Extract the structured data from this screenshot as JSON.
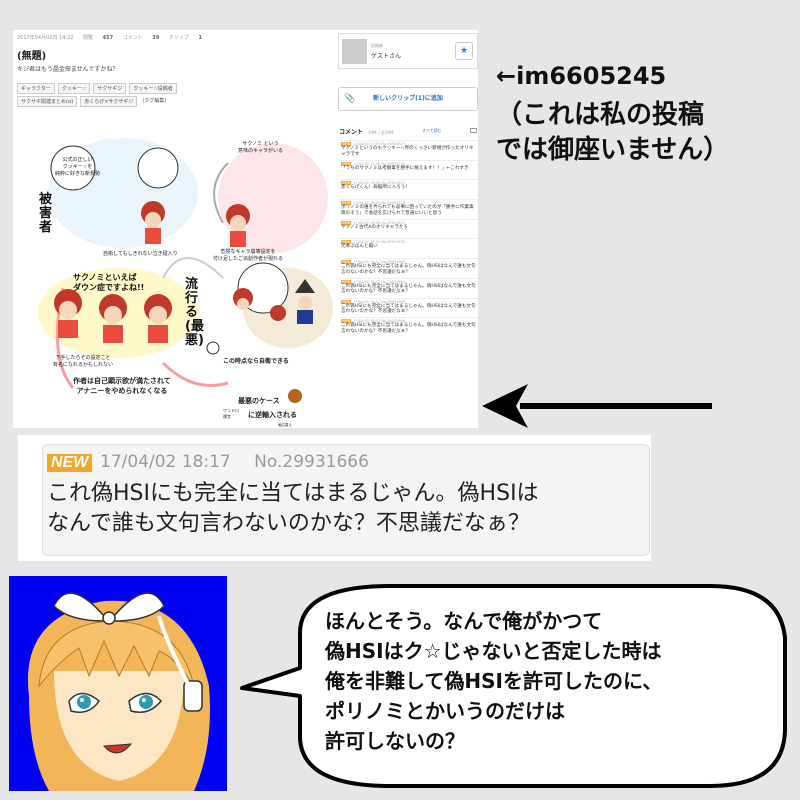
{
  "post": {
    "date_info": "2017年04月02日 14:22",
    "views_label": "閲覧",
    "views": "457",
    "comments_label": "コメント",
    "comments": "39",
    "clips_label": "クリップ",
    "clips": "1",
    "title": "(無題)",
    "description": "キジ君はもう晶金探ませんですかね？",
    "tags_row1": [
      "ギャラクター",
      "クッキー☆",
      "サクサギジ",
      "クッキー☆投稿者"
    ],
    "tags_row2": [
      "サクサギ関連まとめ(α)",
      "赤くらげ×サクサギジ"
    ],
    "tags_locked_label": "(タグ編集)"
  },
  "poster": {
    "label": "投稿者",
    "name": "ゲストさん",
    "star_glyph": "★"
  },
  "clip_button": {
    "label": "新しいクリップ(1)に追加",
    "icon": "paperclip-icon"
  },
  "comic": {
    "label_victim": "被害者",
    "label_trend": "流行る(最悪)",
    "speech_sakanomi": "サクノミといえば\nダウン症ですよね!!",
    "bubble_official": "公式の正しい\nクッキー☆を\n純粋に好きな新規勢",
    "caption_selfharm": "自衛してもしきれない泣き寝入り",
    "bubble_meaning": "サクノミ という\n意味のキャラがいる",
    "caption_spread": "危険なキャラ崩壊設定を\n付け足したご派創作者が現れる",
    "caption_defense": "この時点なら自衛できる",
    "caption_setting": "下手したらその設定こと\n有名になれるかもしれない",
    "caption_author": "作者は自己顕示欲が満たされて\nアナニーをやめられなくなる",
    "worst_case": "最悪のケース",
    "reverse": "に逆輸入される",
    "origin_label": "ワンドロ\n運営",
    "small_note": "画広頁え"
  },
  "comments_panel": {
    "title": "コメント",
    "count": "10件 / 全39件",
    "view_all": "すべて読む",
    "items": [
      {
        "id": "No.29931323",
        "date": "17/04/02 17:53",
        "text": "サクノミというのもクッキー☆界のくっさい新規が作ったオリキャラです"
      },
      {
        "id": "No.29931334",
        "date": "17/04/02 17:56",
        "text": "「うちのサクノミは考察毒を勝手に植えます！！」←これすき"
      },
      {
        "id": "No.29931512",
        "date": "17/04/02 18:06",
        "text": "赤くらげくん！肩擬所に入ろう！"
      },
      {
        "id": "No.29931526",
        "date": "17/04/02 18:06",
        "text": "ポリノミの誰を弄られても返事に困っていたのが「勝手に作業毒障のそう」で会話を広げられて普通にいいと思う"
      },
      {
        "id": "No.29931522",
        "date": "17/04/02 18:08",
        "text": "サクノミ古代Aのオリキャラたろ"
      },
      {
        "id": "No.29931535",
        "date": "17/04/02 18:12",
        "text": "元本ぷほんと擬い"
      },
      {
        "id": "No.29931662",
        "date": "17/04/02 18:17",
        "text": "これ偽HSIにも完全に当てはまるじゃん。偽HSIはなんで誰も文句言わないのかな？不思議だなぁ？"
      },
      {
        "id": "No.29931664",
        "date": "17/04/02 18:17",
        "text": "これ偽HSIにも完全に当てはまるじゃん。偽HSIはなんで誰も文句言わないのかな？不思議だなぁ？"
      },
      {
        "id": "No.29931665",
        "date": "17/04/02 18:17",
        "text": "これ偽HSIにも完全に当てはまるじゃん。偽HSIはなんで誰も文句言わないのかな？不思議だなぁ？"
      },
      {
        "id": "No.29931666",
        "date": "17/04/02 18:17",
        "text": "これ偽HSIにも完全に当てはまるじゃん。偽HSIはなんで誰も文句言わないのかな？不思議だなぁ？"
      }
    ],
    "new_badge": "NEW"
  },
  "annotation": {
    "id_label": "←im6605245",
    "disclaimer": "（これは私の投稿\nでは御座いません）"
  },
  "zoom_comment": {
    "badge": "NEW",
    "date": "17/04/02 18:17",
    "number": "No.29931666",
    "line1": "これ偽HSIにも完全に当てはまるじゃん。偽HSIは",
    "line2": "なんで誰も文句言わないのかな？不思議だなぁ？"
  },
  "speech": {
    "lines": [
      "ほんとそう。なんで俺がかつて",
      "偽HSIはク☆じゃないと否定した時は",
      "俺を非難して偽HSIを許可したのに、",
      "ポリノミとかいうのだけは",
      "許可しないの？"
    ]
  },
  "colors": {
    "new_badge": "#f5a623",
    "character_bg": "#0000f5",
    "link_blue": "#2a6bc0"
  }
}
